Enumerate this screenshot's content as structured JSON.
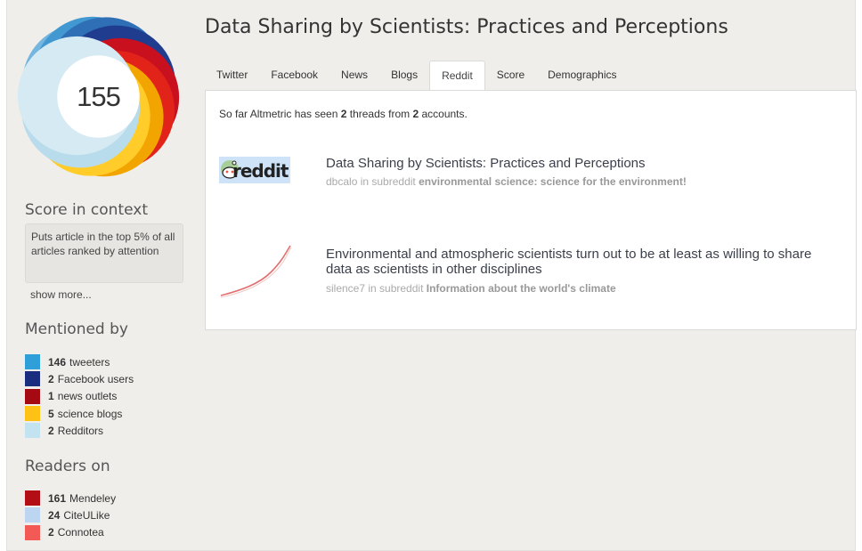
{
  "article": {
    "title": "Data Sharing by Scientists: Practices and Perceptions"
  },
  "score": {
    "value": "155",
    "ring_colors": [
      "#74b6e0",
      "#4299d2",
      "#2f6fb5",
      "#1f3c8f",
      "#c8101e",
      "#e2231a",
      "#f2a400",
      "#ffcc29",
      "#b9dcec",
      "#d6eaf3"
    ]
  },
  "sidebar": {
    "context_heading": "Score in context",
    "context_text": "Puts article in the top 5% of all articles ranked by attention",
    "show_more": "show more...",
    "mentioned_heading": "Mentioned by",
    "mentions": [
      {
        "count": "146",
        "label": "tweeters",
        "color": "#2e9fd8"
      },
      {
        "count": "2",
        "label": "Facebook users",
        "color": "#1a2d7e"
      },
      {
        "count": "1",
        "label": "news outlets",
        "color": "#a50a12"
      },
      {
        "count": "5",
        "label": "science blogs",
        "color": "#fec216"
      },
      {
        "count": "2",
        "label": "Redditors",
        "color": "#c4e3f0"
      }
    ],
    "readers_heading": "Readers on",
    "readers": [
      {
        "count": "161",
        "label": "Mendeley",
        "color": "#b30e15"
      },
      {
        "count": "24",
        "label": "CiteULike",
        "color": "#bcd6f1"
      },
      {
        "count": "2",
        "label": "Connotea",
        "color": "#f45a55"
      }
    ]
  },
  "tabs": [
    "Twitter",
    "Facebook",
    "News",
    "Blogs",
    "Reddit",
    "Score",
    "Demographics"
  ],
  "active_tab": "Reddit",
  "panel": {
    "summary_prefix": "So far Altmetric has seen ",
    "threads_count": "2",
    "summary_middle": " threads from ",
    "accounts_count": "2",
    "summary_suffix": " accounts.",
    "threads": [
      {
        "thumb": "reddit-logo",
        "logo_text": "reddit",
        "title": "Data Sharing by Scientists: Practices and Perceptions",
        "user": "dbcalo",
        "in_text": " in subreddit ",
        "subreddit": "environmental science: science for the environment!"
      },
      {
        "thumb": "chart-thumbnail",
        "title": "Environmental and atmospheric scientists turn out to be at least as willing to share data as scientists in other disciplines",
        "user": "silence7",
        "in_text": " in subreddit ",
        "subreddit": "Information about the world's climate"
      }
    ]
  }
}
